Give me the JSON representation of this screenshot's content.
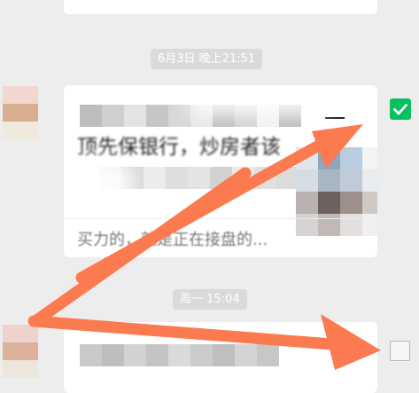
{
  "timestamps": {
    "first": "6月3日 晚上21:51",
    "second": "周一 15:04"
  },
  "message": {
    "line1_partial": "顶先保银行，炒房者该",
    "line1_end": "一",
    "footer_partial": "买力的，就是正在接盘的..."
  },
  "checkboxes": {
    "first_checked": true,
    "second_checked": false
  },
  "icons": {
    "checkmark": "check-icon"
  },
  "colors": {
    "accent_green": "#07c160",
    "arrow": "#fb7a4f",
    "background": "#ededed"
  }
}
